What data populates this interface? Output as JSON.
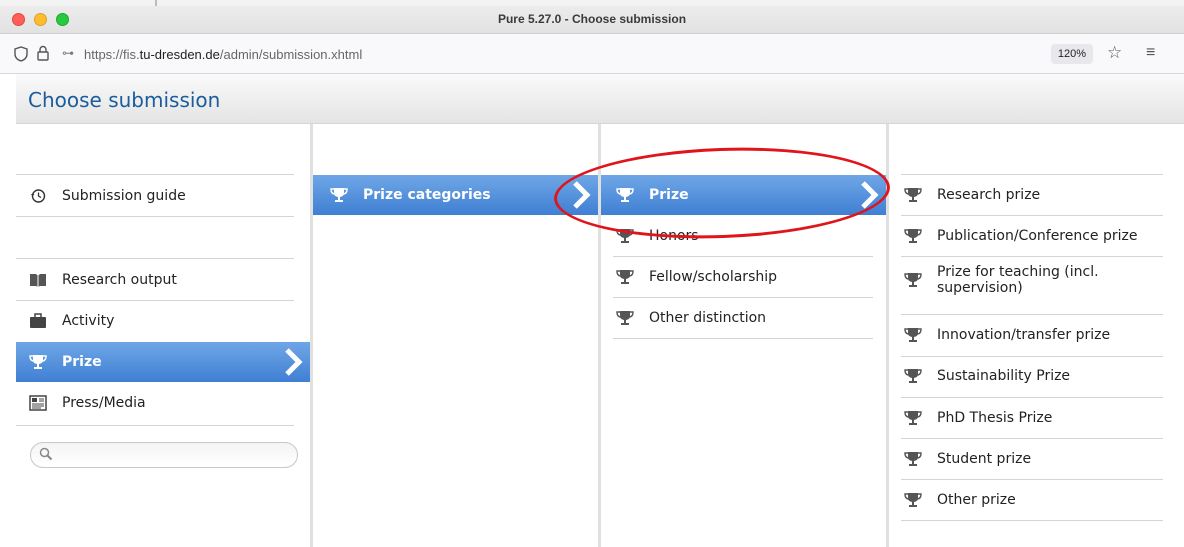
{
  "window": {
    "title": "Pure 5.27.0 - Choose submission"
  },
  "urlbar": {
    "url_prefix": "https://fis.",
    "url_domain": "tu-dresden.de",
    "url_path": "/admin/submission.xhtml",
    "zoom": "120%"
  },
  "page": {
    "title": "Choose submission"
  },
  "col1": {
    "guide": "Submission guide",
    "items": [
      "Research output",
      "Activity",
      "Prize",
      "Press/Media"
    ],
    "selected": "Prize"
  },
  "col2": {
    "items": [
      "Prize categories"
    ]
  },
  "col3": {
    "items": [
      "Prize",
      "Honors",
      "Fellow/scholarship",
      "Other distinction"
    ]
  },
  "col4": {
    "items": [
      "Research prize",
      "Publication/Conference prize",
      "Prize for teaching (incl. supervision)",
      "Innovation/transfer prize",
      "Sustainability Prize",
      "PhD Thesis Prize",
      "Student prize",
      "Other prize"
    ]
  },
  "colors": {
    "accent": "#3f7fd3",
    "title": "#1a5c9e",
    "highlight": "#e0141b"
  },
  "icons": {
    "history": "history-icon",
    "book": "book-icon",
    "briefcase": "briefcase-icon",
    "trophy": "trophy-icon",
    "newspaper": "newspaper-icon",
    "search": "search-icon"
  }
}
